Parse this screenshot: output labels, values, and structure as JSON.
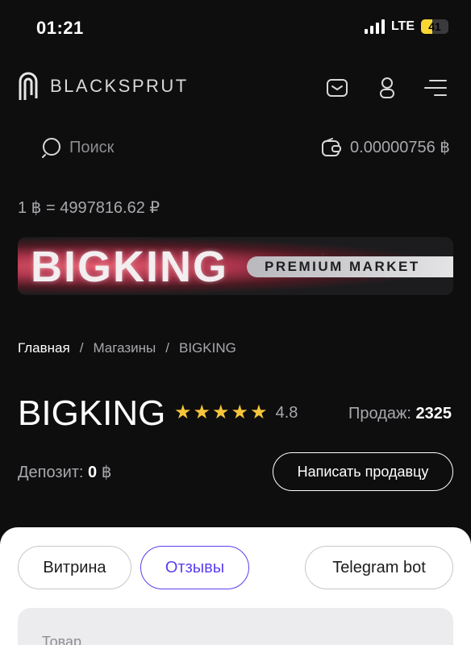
{
  "status": {
    "time": "01:21",
    "network": "LTE",
    "battery": "41",
    "battery_level": 0.41
  },
  "header": {
    "logo_text": "BLACKSPRUT",
    "icons": [
      "mail-icon",
      "user-icon",
      "menu-icon"
    ]
  },
  "search": {
    "placeholder": "Поиск"
  },
  "wallet": {
    "balance": "0.00000756 ฿"
  },
  "rate": {
    "text": "1 ฿ = 4997816.62 ₽"
  },
  "banner": {
    "title": "BIGKING",
    "tagline": "PREMIUM MARKET"
  },
  "breadcrumb": {
    "items": [
      "Главная",
      "Магазины",
      "BIGKING"
    ],
    "separator": "/"
  },
  "shop": {
    "name": "BIGKING",
    "stars": 5,
    "rating": "4.8",
    "sales_label": "Продаж:",
    "sales_value": "2325",
    "deposit_label": "Депозит:",
    "deposit_value": "0",
    "deposit_currency": "฿",
    "write_button": "Написать продавцу"
  },
  "tabs": [
    {
      "label": "Витрина",
      "active": false
    },
    {
      "label": "Отзывы",
      "active": true
    },
    {
      "label": "Telegram bot",
      "active": false
    }
  ],
  "form": {
    "product_label": "Товар"
  },
  "colors": {
    "accent": "#5b3ff0",
    "star": "#f6c53a",
    "background": "#0e0e0f"
  }
}
